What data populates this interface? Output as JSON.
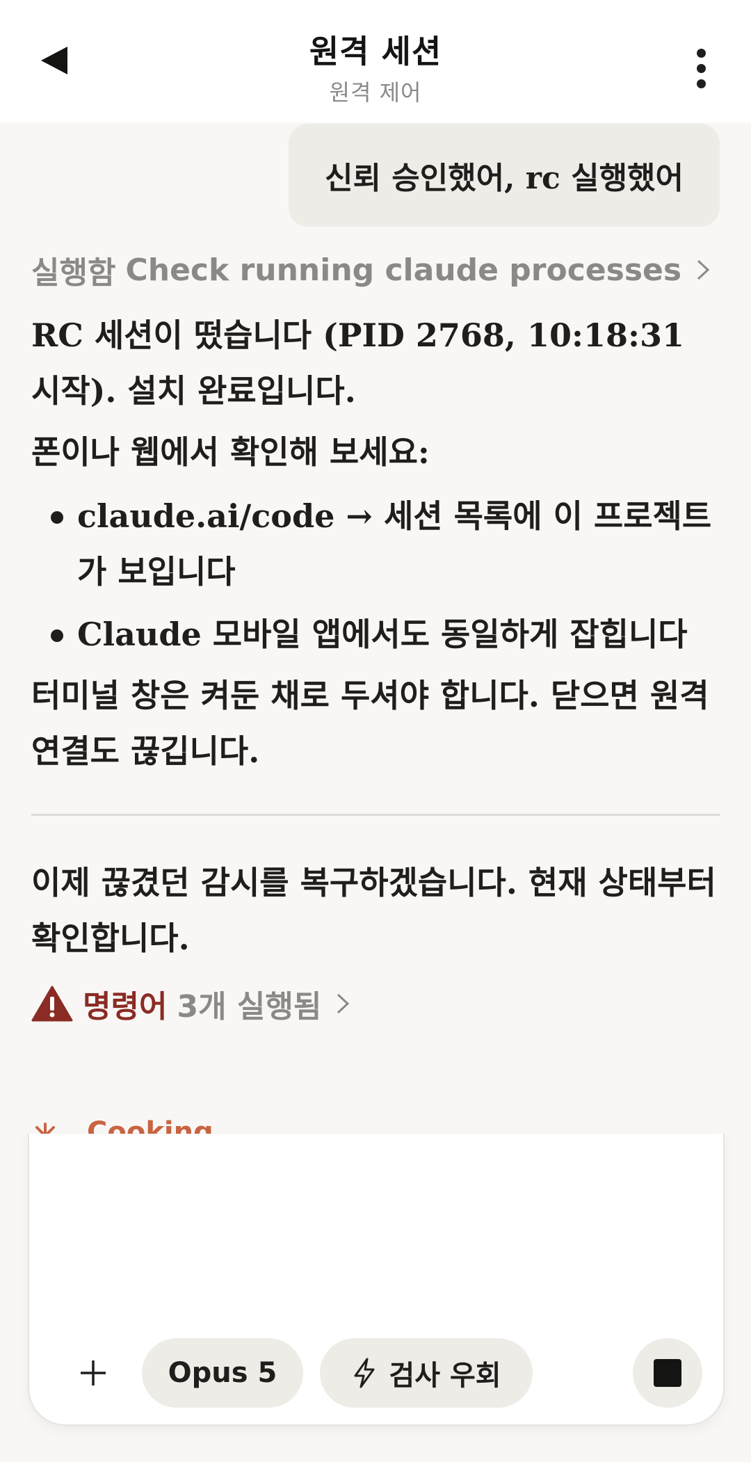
{
  "header": {
    "title": "원격 세션",
    "subtitle": "원격 제어"
  },
  "user_message": "신뢰 승인했어, rc 실행했어",
  "assistant": {
    "tool_call": {
      "prefix": "실행함",
      "label": "Check running claude processes"
    },
    "para1": "RC 세션이 떴습니다 (PID 2768, 10:18:31 시작). 설치 완료입니다.",
    "para2": "폰이나 웹에서 확인해 보세요:",
    "bullets": [
      "claude.ai/code → 세션 목록에 이 프로젝트가 보입니다",
      "Claude 모바일 앱에서도 동일하게 잡힙니다"
    ],
    "para3": "터미널 창은 켜둔 채로 두셔야 합니다. 닫으면 원격 연결도 끊깁니다.",
    "para4": "이제 끊겼던 감시를 복구하겠습니다. 현재 상태부터 확인합니다.",
    "commands": {
      "label": "명령어",
      "count_text": "3개 실행됨"
    },
    "status": "Cooking"
  },
  "composer": {
    "model_label": "Opus 5",
    "mode_label": "검사 우회"
  },
  "colors": {
    "background": "#f8f7f5",
    "bubble": "#eeece7",
    "warning": "#8a2b24",
    "accent": "#c96442",
    "muted": "#8a8987"
  },
  "icons": {
    "back": "back-arrow-icon",
    "menu": "more-vertical-icon",
    "chevron": "chevron-right-icon",
    "warning": "warning-triangle-icon",
    "spinner": "asterisk-spinner-icon",
    "plus": "plus-icon",
    "bolt": "lightning-icon",
    "stop": "stop-icon"
  }
}
